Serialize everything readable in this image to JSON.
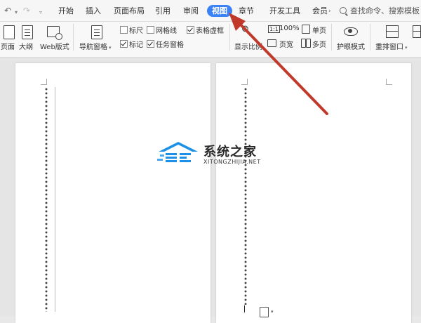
{
  "quick_access": {
    "undo_icon": "undo-icon",
    "redo_icon": "redo-icon",
    "customize_icon": "dropdown-icon"
  },
  "tabs": [
    {
      "label": "开始"
    },
    {
      "label": "插入"
    },
    {
      "label": "页面布局"
    },
    {
      "label": "引用"
    },
    {
      "label": "审阅"
    },
    {
      "label": "视图",
      "active": true
    },
    {
      "label": "章节"
    },
    {
      "label": "开发工具"
    },
    {
      "label": "会员"
    }
  ],
  "search": {
    "placeholder": "查找命令、搜索模板"
  },
  "ribbon": {
    "page_view": "页面",
    "outline": "大纲",
    "web_layout": "Web版式",
    "nav_pane": "导航窗格",
    "ruler": "标尺",
    "gridlines": "网格线",
    "table_gridlines": "表格虚框",
    "markers": "标记",
    "task_pane": "任务窗格",
    "show_scale": "显示比例",
    "zoom_100": "100%",
    "single_page": "单页",
    "page_width": "页宽",
    "multi_page": "多页",
    "eye_protection": "护眼模式",
    "arrange_windows": "重排窗口",
    "checks": {
      "ruler": false,
      "gridlines": false,
      "table_gridlines": true,
      "markers": true,
      "task_pane": true
    }
  },
  "watermark": {
    "title": "系统之家",
    "subtitle": "XITONGZHIJIA.NET"
  },
  "colors": {
    "accent": "#3b82f6",
    "arrow": "#c0392b",
    "logo_blue": "#1d8fe6"
  }
}
